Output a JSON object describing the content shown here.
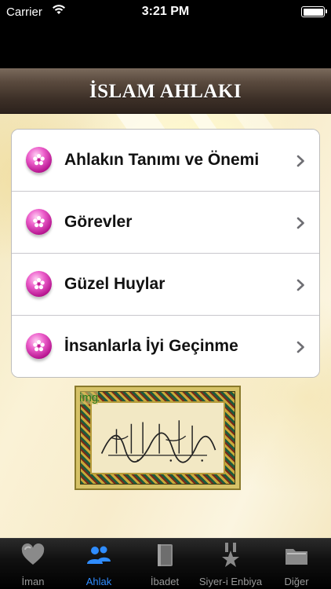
{
  "status_bar": {
    "carrier": "Carrier",
    "time": "3:21 PM",
    "battery_level": 1.0
  },
  "header": {
    "title": "İSLAM AHLAKI"
  },
  "menu": {
    "items": [
      {
        "label": "Ahlakın Tanımı ve Önemi",
        "icon": "pink-flower-orb-icon"
      },
      {
        "label": "Görevler",
        "icon": "pink-flower-orb-icon"
      },
      {
        "label": "Güzel Huylar",
        "icon": "pink-flower-orb-icon"
      },
      {
        "label": "İnsanlarla İyi Geçinme",
        "icon": "pink-flower-orb-icon"
      }
    ]
  },
  "calligraphy": {
    "label": "img"
  },
  "tabbar": {
    "active_index": 1,
    "tabs": [
      {
        "label": "İman",
        "icon": "heart-icon"
      },
      {
        "label": "Ahlak",
        "icon": "people-icon"
      },
      {
        "label": "İbadet",
        "icon": "book-icon"
      },
      {
        "label": "Siyer-i Enbiya",
        "icon": "star-badge-icon"
      },
      {
        "label": "Diğer",
        "icon": "folder-icon"
      }
    ]
  },
  "colors": {
    "accent": "#2f8cff",
    "header_dark": "#3c2f27",
    "orb_pink": "#d12fa8"
  }
}
